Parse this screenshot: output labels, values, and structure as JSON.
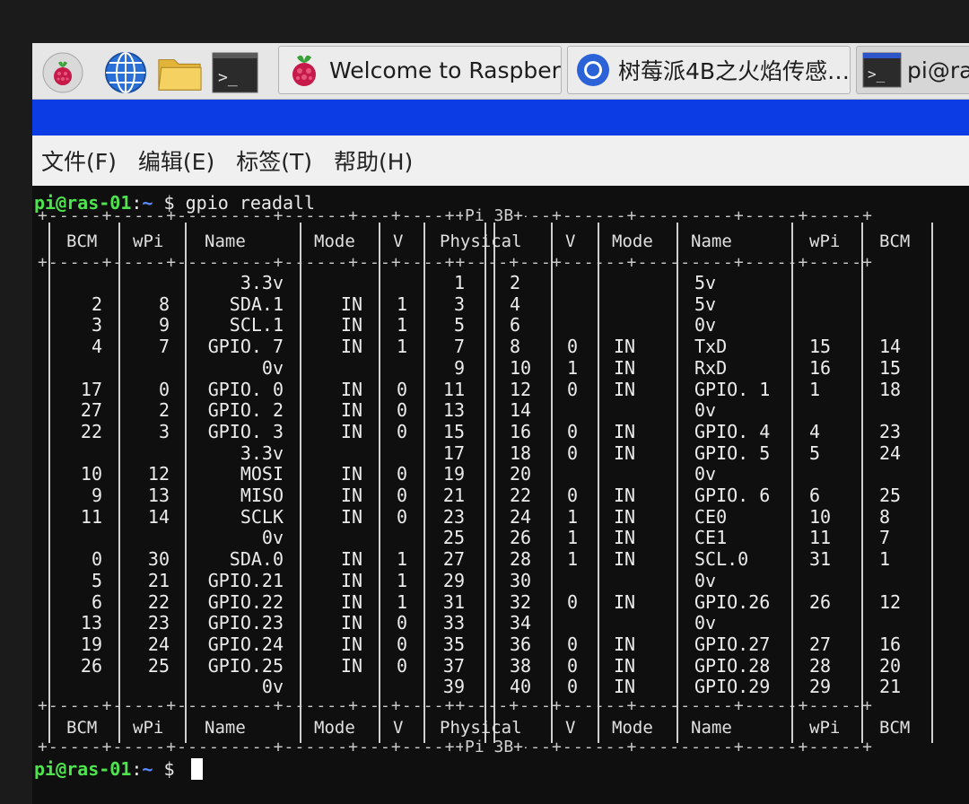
{
  "taskbar": {
    "launchers": [
      {
        "name": "raspberry-menu-icon"
      },
      {
        "name": "web-browser-icon"
      },
      {
        "name": "file-manager-icon"
      },
      {
        "name": "terminal-icon"
      }
    ],
    "tasks": [
      {
        "label": "Welcome to Raspberr…",
        "icon": "raspberry-icon"
      },
      {
        "label": "树莓派4B之火焰传感…",
        "icon": "chromium-icon"
      },
      {
        "label": "pi@ras",
        "icon": "terminal-icon"
      }
    ]
  },
  "menu": [
    "文件(F)",
    "编辑(E)",
    "标签(T)",
    "帮助(H)"
  ],
  "terminal": {
    "prompt_user": "pi@ras-01",
    "prompt_sep": ":",
    "prompt_dir": "~",
    "prompt_sym": "$",
    "command": "gpio readall",
    "board_label": "Pi 3B+",
    "columns": [
      "BCM",
      "wPi",
      "Name",
      "Mode",
      "V",
      "Physical",
      "V",
      "Mode",
      "Name",
      "wPi",
      "BCM"
    ],
    "rows": [
      [
        "",
        "",
        "3.3v",
        "",
        "",
        "1",
        "2",
        "",
        "",
        "5v",
        "",
        ""
      ],
      [
        "2",
        "8",
        "SDA.1",
        "IN",
        "1",
        "3",
        "4",
        "",
        "",
        "5v",
        "",
        ""
      ],
      [
        "3",
        "9",
        "SCL.1",
        "IN",
        "1",
        "5",
        "6",
        "",
        "",
        "0v",
        "",
        ""
      ],
      [
        "4",
        "7",
        "GPIO. 7",
        "IN",
        "1",
        "7",
        "8",
        "0",
        "IN",
        "TxD",
        "15",
        "14"
      ],
      [
        "",
        "",
        "0v",
        "",
        "",
        "9",
        "10",
        "1",
        "IN",
        "RxD",
        "16",
        "15"
      ],
      [
        "17",
        "0",
        "GPIO. 0",
        "IN",
        "0",
        "11",
        "12",
        "0",
        "IN",
        "GPIO. 1",
        "1",
        "18"
      ],
      [
        "27",
        "2",
        "GPIO. 2",
        "IN",
        "0",
        "13",
        "14",
        "",
        "",
        "0v",
        "",
        ""
      ],
      [
        "22",
        "3",
        "GPIO. 3",
        "IN",
        "0",
        "15",
        "16",
        "0",
        "IN",
        "GPIO. 4",
        "4",
        "23"
      ],
      [
        "",
        "",
        "3.3v",
        "",
        "",
        "17",
        "18",
        "0",
        "IN",
        "GPIO. 5",
        "5",
        "24"
      ],
      [
        "10",
        "12",
        "MOSI",
        "IN",
        "0",
        "19",
        "20",
        "",
        "",
        "0v",
        "",
        ""
      ],
      [
        "9",
        "13",
        "MISO",
        "IN",
        "0",
        "21",
        "22",
        "0",
        "IN",
        "GPIO. 6",
        "6",
        "25"
      ],
      [
        "11",
        "14",
        "SCLK",
        "IN",
        "0",
        "23",
        "24",
        "1",
        "IN",
        "CE0",
        "10",
        "8"
      ],
      [
        "",
        "",
        "0v",
        "",
        "",
        "25",
        "26",
        "1",
        "IN",
        "CE1",
        "11",
        "7"
      ],
      [
        "0",
        "30",
        "SDA.0",
        "IN",
        "1",
        "27",
        "28",
        "1",
        "IN",
        "SCL.0",
        "31",
        "1"
      ],
      [
        "5",
        "21",
        "GPIO.21",
        "IN",
        "1",
        "29",
        "30",
        "",
        "",
        "0v",
        "",
        ""
      ],
      [
        "6",
        "22",
        "GPIO.22",
        "IN",
        "1",
        "31",
        "32",
        "0",
        "IN",
        "GPIO.26",
        "26",
        "12"
      ],
      [
        "13",
        "23",
        "GPIO.23",
        "IN",
        "0",
        "33",
        "34",
        "",
        "",
        "0v",
        "",
        ""
      ],
      [
        "19",
        "24",
        "GPIO.24",
        "IN",
        "0",
        "35",
        "36",
        "0",
        "IN",
        "GPIO.27",
        "27",
        "16"
      ],
      [
        "26",
        "25",
        "GPIO.25",
        "IN",
        "0",
        "37",
        "38",
        "0",
        "IN",
        "GPIO.28",
        "28",
        "20"
      ],
      [
        "",
        "",
        "0v",
        "",
        "",
        "39",
        "40",
        "0",
        "IN",
        "GPIO.29",
        "29",
        "21"
      ]
    ]
  },
  "colors": {
    "title_bar": "#0c3ce4",
    "prompt_user": "#4ee44e",
    "prompt_dir": "#5a8cff"
  }
}
